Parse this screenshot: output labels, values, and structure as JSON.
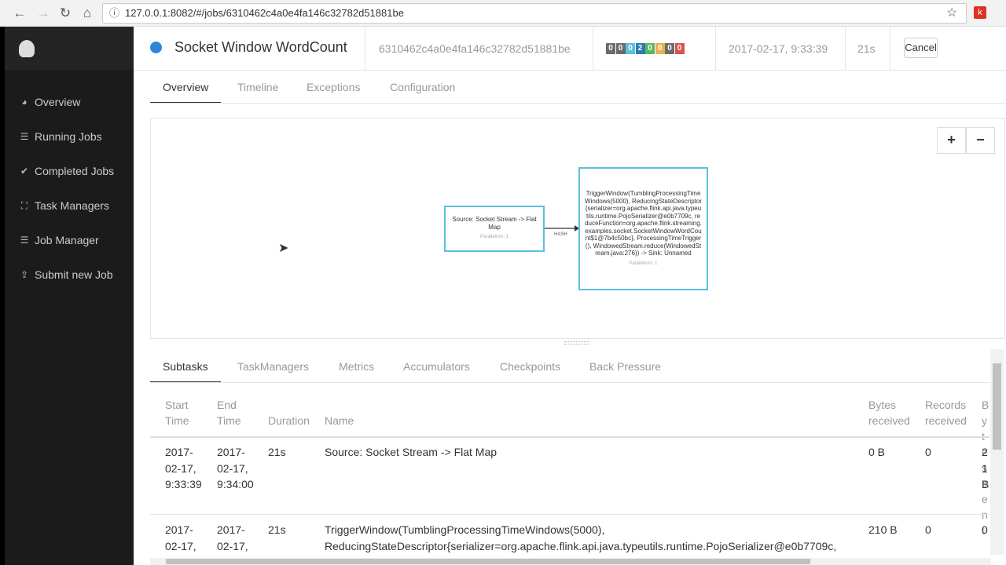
{
  "browser": {
    "url": "127.0.0.1:8082/#/jobs/6310462c4a0e4fa146c32782d51881be"
  },
  "sidebar": {
    "items": [
      {
        "label": "Overview",
        "icon": "dashboard-icon"
      },
      {
        "label": "Running Jobs",
        "icon": "tasks-icon"
      },
      {
        "label": "Completed Jobs",
        "icon": "check-circle-icon"
      },
      {
        "label": "Task Managers",
        "icon": "sitemap-icon"
      },
      {
        "label": "Job Manager",
        "icon": "server-icon"
      },
      {
        "label": "Submit new Job",
        "icon": "upload-icon"
      }
    ]
  },
  "job": {
    "name": "Socket Window WordCount",
    "id": "6310462c4a0e4fa146c32782d51881be",
    "start": "2017-02-17, 9:33:39",
    "duration": "21s",
    "cancel": "Cancel",
    "task_counts": [
      {
        "v": "0",
        "c": "#6b6b6b"
      },
      {
        "v": "0",
        "c": "#6b6b6b"
      },
      {
        "v": "0",
        "c": "#5bc0de"
      },
      {
        "v": "2",
        "c": "#2a7ab0"
      },
      {
        "v": "0",
        "c": "#5cb85c"
      },
      {
        "v": "0",
        "c": "#f0ad4e"
      },
      {
        "v": "0",
        "c": "#6b6b6b"
      },
      {
        "v": "0",
        "c": "#d9534f"
      }
    ]
  },
  "tabs": [
    "Overview",
    "Timeline",
    "Exceptions",
    "Configuration"
  ],
  "graph": {
    "zoom_in": "+",
    "zoom_out": "−",
    "edge": "HASH",
    "nodes": [
      {
        "text": "Source: Socket Stream -> Flat Map",
        "par": "Parallelism: 1"
      },
      {
        "text": "TriggerWindow(TumblingProcessingTimeWindows(5000), ReducingStateDescriptor{serializer=org.apache.flink.api.java.typeutils.runtime.PojoSerializer@e0b7709c, reduceFunction=org.apache.flink.streaming.examples.socket.SocketWindowWordCount$1@7b4c50bc}, ProcessingTimeTrigger(), WindowedStream.reduce(WindowedStream.java:276)) -> Sink: Unnamed",
        "par": "Parallelism: 1"
      }
    ]
  },
  "subtabs": [
    "Subtasks",
    "TaskManagers",
    "Metrics",
    "Accumulators",
    "Checkpoints",
    "Back Pressure"
  ],
  "table": {
    "headers": [
      "Start Time",
      "End Time",
      "Duration",
      "Name",
      "Bytes received",
      "Records received",
      "Bytes sent"
    ],
    "rows": [
      {
        "start": "2017-02-17, 9:33:39",
        "end": "2017-02-17, 9:34:00",
        "duration": "21s",
        "name": "Source: Socket Stream -> Flat Map",
        "bytes_received": "0 B",
        "records_received": "0",
        "bytes_sent": "21 B"
      },
      {
        "start": "2017-02-17,",
        "end": "2017-02-17,",
        "duration": "21s",
        "name": "TriggerWindow(TumblingProcessingTimeWindows(5000), ReducingStateDescriptor{serializer=org.apache.flink.api.java.typeutils.runtime.PojoSerializer@e0b7709c,",
        "bytes_received": "210 B",
        "records_received": "0",
        "bytes_sent": "0"
      }
    ]
  }
}
